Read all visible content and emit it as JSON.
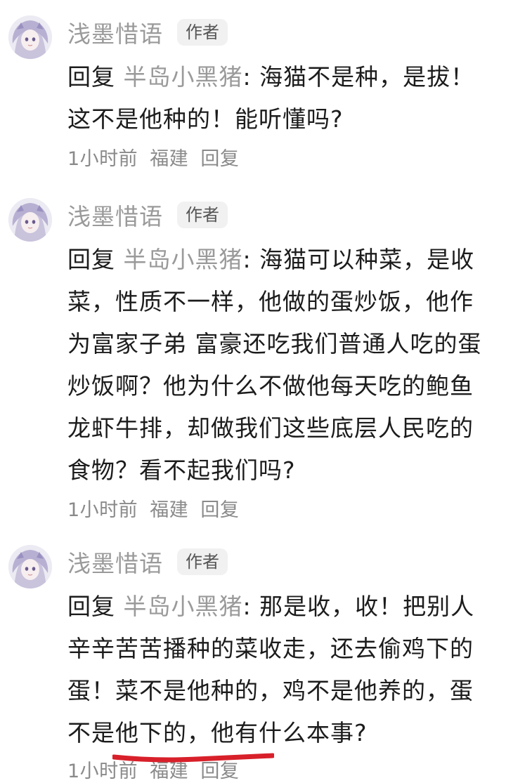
{
  "comments": [
    {
      "username": "浅墨惜语",
      "badge": "作者",
      "reply_prefix": "回复",
      "mention": "半岛小黑猪",
      "separator": ": ",
      "text": "海猫不是种，是拔！这不是他种的！能听懂吗?",
      "time": "1小时前",
      "location": "福建",
      "reply_label": "回复"
    },
    {
      "username": "浅墨惜语",
      "badge": "作者",
      "reply_prefix": "回复",
      "mention": "半岛小黑猪",
      "separator": ": ",
      "text": "海猫可以种菜，是收菜，性质不一样，他做的蛋炒饭，他作为富家子弟 富豪还吃我们普通人吃的蛋炒饭啊？他为什么不做他每天吃的鲍鱼龙虾牛排，却做我们这些底层人民吃的食物？看不起我们吗?",
      "time": "1小时前",
      "location": "福建",
      "reply_label": "回复"
    },
    {
      "username": "浅墨惜语",
      "badge": "作者",
      "reply_prefix": "回复",
      "mention": "半岛小黑猪",
      "separator": ": ",
      "text": "那是收，收！把别人辛辛苦苦播种的菜收走，还去偷鸡下的蛋！菜不是他种的，鸡不是他养的，蛋不是他下的，他有什么本事?",
      "time": "1小时前",
      "location": "福建",
      "reply_label": "回复"
    }
  ],
  "colors": {
    "username": "#9a9a9a",
    "mention": "#9a9a9a",
    "body": "#1c1c1c",
    "meta": "#8a8a8a",
    "badge_bg": "#f1f1f1",
    "highlight_underline": "#d8202a"
  },
  "icons": {
    "avatar": "anime-girl-avatar-icon"
  }
}
